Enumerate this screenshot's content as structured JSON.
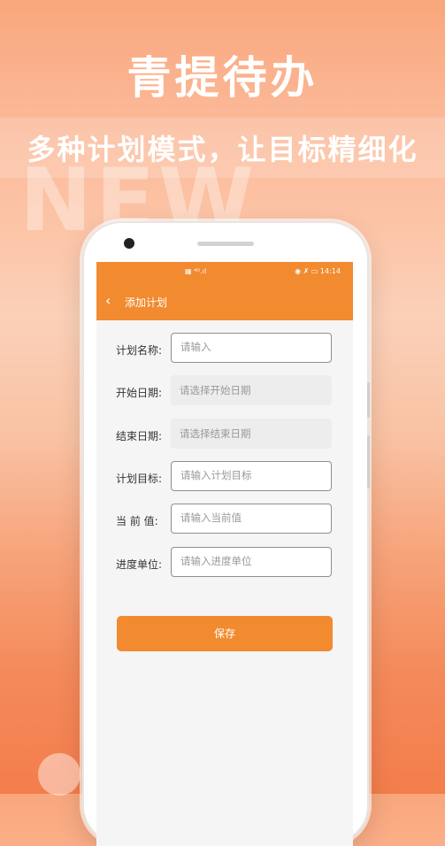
{
  "header": {
    "title": "青提待办",
    "subtitle": "多种计划模式，让目标精细化",
    "watermark": "NEW"
  },
  "statusbar": {
    "center": "▦ ⁴ᴳ.ıl",
    "right": "◉ ✗ ▭ 14:14",
    "time": "14:14"
  },
  "appbar": {
    "back_icon": "‹",
    "title": "添加计划"
  },
  "form": {
    "fields": [
      {
        "label": "计划名称:",
        "placeholder": "请输入"
      },
      {
        "label": "开始日期:",
        "placeholder": "请选择开始日期"
      },
      {
        "label": "结束日期:",
        "placeholder": "请选择结束日期"
      },
      {
        "label": "计划目标:",
        "placeholder": "请输入计划目标"
      },
      {
        "label": "当 前 值:",
        "placeholder": "请输入当前值"
      },
      {
        "label": "进度单位:",
        "placeholder": "请输入进度单位"
      }
    ],
    "save_label": "保存"
  },
  "colors": {
    "accent": "#f28b30",
    "background_top": "#f9a77c",
    "background_bottom": "#f47d4c"
  }
}
